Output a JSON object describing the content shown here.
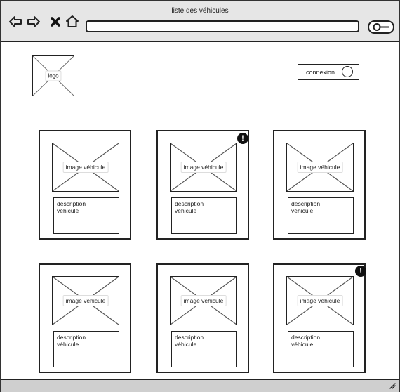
{
  "window": {
    "title": "liste des véhicules"
  },
  "toolbar": {
    "icons": [
      "back-arrow-icon",
      "forward-arrow-icon",
      "close-icon",
      "home-icon",
      "search-icon"
    ],
    "url": {
      "value": "",
      "placeholder": ""
    }
  },
  "header": {
    "logo_label": "logo",
    "login_label": "connexion"
  },
  "vehicles": [
    {
      "image_label": "image véhicule",
      "description": "description\nvéhicule",
      "alert": false
    },
    {
      "image_label": "image véhicule",
      "description": "description\nvéhicule",
      "alert": true
    },
    {
      "image_label": "image véhicule",
      "description": "description\nvéhicule",
      "alert": false
    },
    {
      "image_label": "image véhicule",
      "description": "description\nvéhicule",
      "alert": false
    },
    {
      "image_label": "image véhicule",
      "description": "description\nvéhicule",
      "alert": false
    },
    {
      "image_label": "image véhicule",
      "description": "description\nvéhicule",
      "alert": true
    }
  ],
  "alert_symbol": "!",
  "colors": {
    "chrome": "#e6e6e6",
    "ink": "#222222",
    "footer": "#cfcfcf"
  }
}
